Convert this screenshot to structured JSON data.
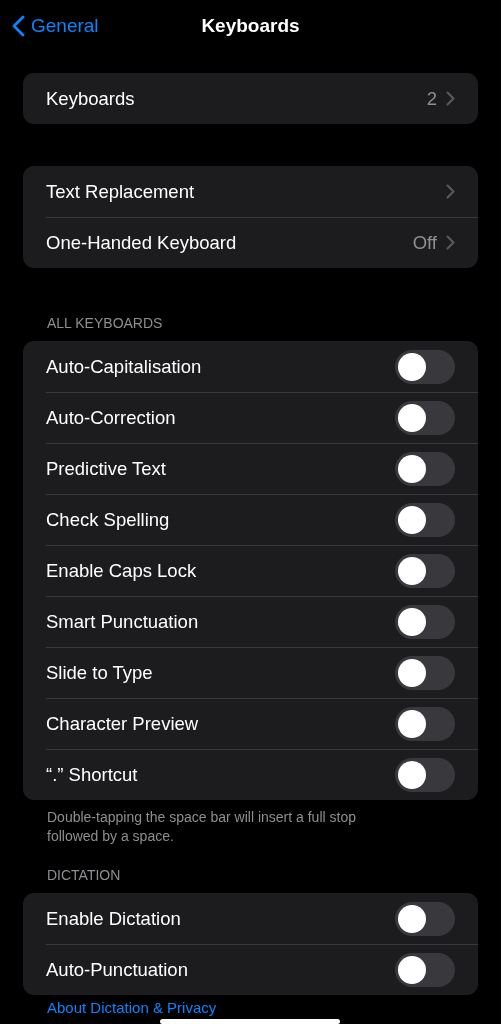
{
  "nav": {
    "back": "General",
    "title": "Keyboards"
  },
  "groups": [
    {
      "rows": [
        {
          "kind": "link",
          "label": "Keyboards",
          "value": "2"
        }
      ]
    },
    {
      "rows": [
        {
          "kind": "link",
          "label": "Text Replacement"
        },
        {
          "kind": "link",
          "label": "One-Handed Keyboard",
          "value": "Off"
        }
      ]
    },
    {
      "header": "ALL KEYBOARDS",
      "rows": [
        {
          "kind": "toggle",
          "label": "Auto-Capitalisation",
          "on": false
        },
        {
          "kind": "toggle",
          "label": "Auto-Correction",
          "on": false
        },
        {
          "kind": "toggle",
          "label": "Predictive Text",
          "on": false
        },
        {
          "kind": "toggle",
          "label": "Check Spelling",
          "on": false
        },
        {
          "kind": "toggle",
          "label": "Enable Caps Lock",
          "on": false
        },
        {
          "kind": "toggle",
          "label": "Smart Punctuation",
          "on": false
        },
        {
          "kind": "toggle",
          "label": "Slide to Type",
          "on": false
        },
        {
          "kind": "toggle",
          "label": "Character Preview",
          "on": false
        },
        {
          "kind": "toggle",
          "label": "“.” Shortcut",
          "on": false
        }
      ],
      "footer": "Double-tapping the space bar will insert a full stop followed by a space."
    },
    {
      "header": "DICTATION",
      "rows": [
        {
          "kind": "toggle",
          "label": "Enable Dictation",
          "on": false
        },
        {
          "kind": "toggle",
          "label": "Auto-Punctuation",
          "on": false
        }
      ],
      "link": "About Dictation & Privacy"
    }
  ]
}
